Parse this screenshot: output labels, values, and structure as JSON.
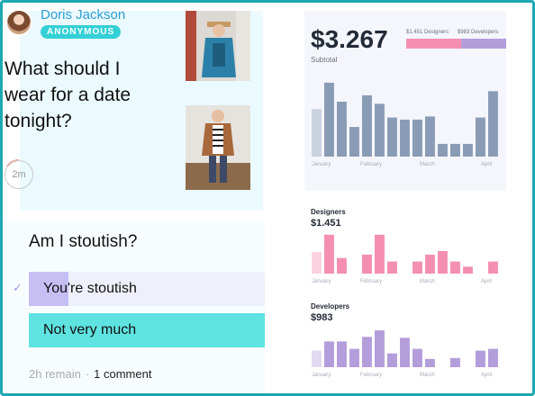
{
  "post": {
    "author_name": "Doris Jackson",
    "badge": "ANONYMOUS",
    "question": "What should I wear for a date tonight?",
    "timer": "2m"
  },
  "poll": {
    "question": "Am I stoutish?",
    "options": [
      {
        "label": "You're stoutish",
        "selected": true
      },
      {
        "label": "Not very much",
        "selected": false
      }
    ],
    "time_remaining": "2h remain",
    "separator": "·",
    "comments": "1 comment"
  },
  "summary": {
    "value": "$3.267",
    "label": "Subtotal",
    "legend": [
      {
        "name": "$1.451 Designers",
        "color": "#f48fb1"
      },
      {
        "name": "$983 Developers",
        "color": "#b39ddb"
      }
    ]
  },
  "chart_data": [
    {
      "type": "bar",
      "title": "Subtotal",
      "categories": [
        "January",
        "",
        "",
        "",
        "February",
        "",
        "",
        "",
        "",
        "March",
        "",
        "",
        "",
        "",
        "April"
      ],
      "x_labels": [
        "January",
        "February",
        "March",
        "April"
      ],
      "values": [
        45,
        70,
        52,
        28,
        58,
        50,
        37,
        35,
        35,
        38,
        12,
        12,
        12,
        37,
        62
      ],
      "faded_first": true,
      "color": "#8a9bb5"
    },
    {
      "type": "bar",
      "title": "Designers",
      "value_label": "$1.451",
      "x_labels": [
        "January",
        "February",
        "March",
        "April"
      ],
      "values": [
        25,
        45,
        18,
        0,
        22,
        45,
        14,
        0,
        14,
        22,
        26,
        14,
        8,
        0,
        14
      ],
      "faded_first": true,
      "color": "#f48fb1"
    },
    {
      "type": "bar",
      "title": "Developers",
      "value_label": "$983",
      "x_labels": [
        "January",
        "February",
        "March",
        "April"
      ],
      "values": [
        18,
        28,
        28,
        20,
        33,
        40,
        15,
        32,
        20,
        9,
        0,
        10,
        0,
        18,
        20
      ],
      "faded_first": true,
      "color": "#b39ddb"
    }
  ]
}
